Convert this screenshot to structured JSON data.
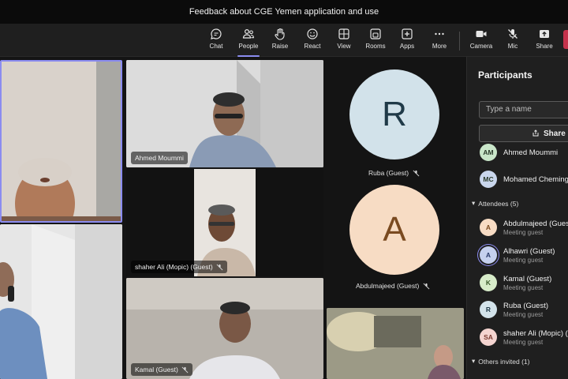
{
  "window": {
    "title": "Feedback about CGE Yemen application and use"
  },
  "toolbar": {
    "items": [
      {
        "label": "Chat",
        "icon": "chat-icon"
      },
      {
        "label": "People",
        "icon": "people-icon",
        "active": true
      },
      {
        "label": "Raise",
        "icon": "raise-hand-icon"
      },
      {
        "label": "React",
        "icon": "react-icon"
      },
      {
        "label": "View",
        "icon": "view-icon"
      },
      {
        "label": "Rooms",
        "icon": "rooms-icon"
      },
      {
        "label": "Apps",
        "icon": "apps-icon"
      },
      {
        "label": "More",
        "icon": "more-icon"
      },
      {
        "label": "Camera",
        "icon": "camera-icon"
      },
      {
        "label": "Mic",
        "icon": "mic-off-icon"
      },
      {
        "label": "Share",
        "icon": "share-icon"
      }
    ]
  },
  "stage": {
    "tiles": {
      "ahmed": "Ahmed Moummi",
      "shaher": "shaher Ali (Mopic) (Guest)",
      "kamal": "Kamal (Guest)",
      "ruba": {
        "initial": "R",
        "label": "Ruba (Guest)"
      },
      "abdulmajeed": {
        "initial": "A",
        "label": "Abdulmajeed (Guest)"
      }
    }
  },
  "panel": {
    "title": "Participants",
    "search_placeholder": "Type a name",
    "share_label": "Share i",
    "organizers": [
      {
        "initials": "AM",
        "name": "Ahmed Moummi",
        "color": "#c9e6c9"
      },
      {
        "initials": "MC",
        "name": "Mohamed Cheming",
        "color": "#c9d6ec"
      }
    ],
    "attendees_header": "Attendees (5)",
    "attendees": [
      {
        "initials": "A",
        "name": "Abdulmajeed (Gues",
        "role": "Meeting guest",
        "color": "#f7dcc4"
      },
      {
        "initials": "A",
        "name": "Alhawri (Guest)",
        "role": "Meeting guest",
        "color": "#c5d0ee"
      },
      {
        "initials": "K",
        "name": "Kamal (Guest)",
        "role": "Meeting guest",
        "color": "#d7ecc9"
      },
      {
        "initials": "R",
        "name": "Ruba (Guest)",
        "role": "Meeting guest",
        "color": "#d3e3ea"
      },
      {
        "initials": "SA",
        "name": "shaher Ali (Mopic) (",
        "role": "Meeting guest",
        "color": "#f4d4d0"
      }
    ],
    "others_header": "Others invited (1)"
  }
}
